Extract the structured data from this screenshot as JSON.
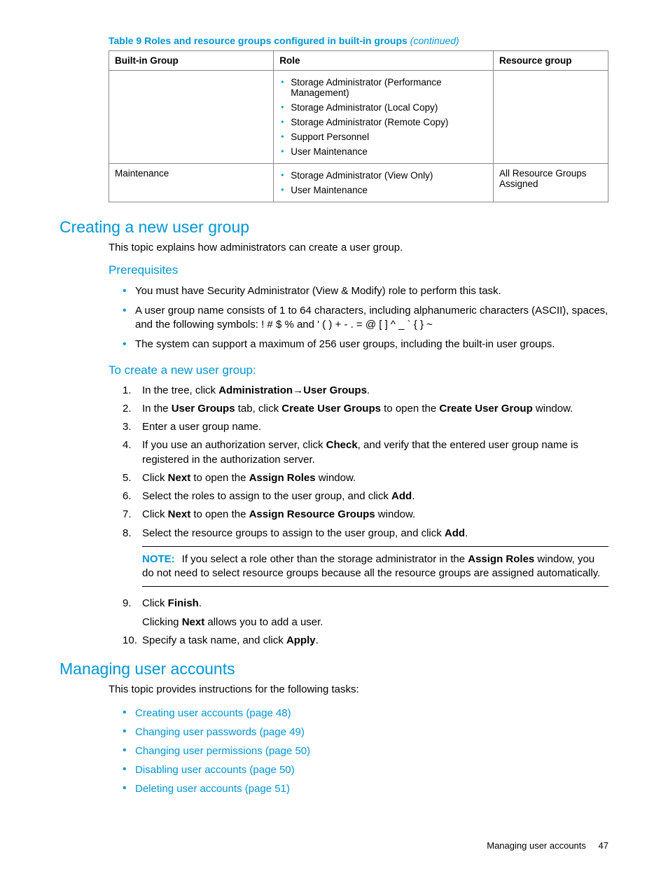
{
  "tableCaption": {
    "main": "Table 9 Roles and resource groups configured in built-in groups",
    "cont": "(continued)"
  },
  "table": {
    "headers": {
      "c1": "Built-in Group",
      "c2": "Role",
      "c3": "Resource group"
    },
    "row1": {
      "group": "",
      "roles": [
        "Storage Administrator (Performance Management)",
        "Storage Administrator (Local Copy)",
        "Storage Administrator (Remote Copy)",
        "Support Personnel",
        "User Maintenance"
      ],
      "rg": ""
    },
    "row2": {
      "group": "Maintenance",
      "roles": [
        "Storage Administrator (View Only)",
        "User Maintenance"
      ],
      "rg": "All Resource Groups Assigned"
    }
  },
  "s1": {
    "title": "Creating a new user group",
    "intro": "This topic explains how administrators can create a user group.",
    "prereqTitle": "Prerequisites",
    "prereqs": [
      "You must have Security Administrator (View & Modify) role to perform this task.",
      "A user group name consists of 1 to 64 characters, including alphanumeric characters (ASCII), spaces, and the following symbols: ! # $ % and ' ( ) + - . = @ [ ] ^ _ ` { } ~",
      "The system can support a maximum of 256 user groups, including the built-in user groups."
    ],
    "stepsTitle": "To create a new user group:",
    "steps": {
      "s1a": "In the tree, click ",
      "s1b": "Administration",
      "s1arrow": "→",
      "s1c": "User Groups",
      "s1d": ".",
      "s2a": "In the ",
      "s2b": "User Groups",
      "s2c": " tab, click ",
      "s2d": "Create User Groups",
      "s2e": " to open the ",
      "s2f": "Create User Group",
      "s2g": " window.",
      "s3": "Enter a user group name.",
      "s4a": "If you use an authorization server, click ",
      "s4b": "Check",
      "s4c": ", and verify that the entered user group name is registered in the authorization server.",
      "s5a": "Click ",
      "s5b": "Next",
      "s5c": " to open the ",
      "s5d": "Assign Roles",
      "s5e": " window.",
      "s6a": "Select the roles to assign to the user group, and click ",
      "s6b": "Add",
      "s6c": ".",
      "s7a": "Click ",
      "s7b": "Next",
      "s7c": " to open the ",
      "s7d": "Assign Resource Groups",
      "s7e": " window.",
      "s8a": "Select the resource groups to assign to the user group, and click ",
      "s8b": "Add",
      "s8c": ".",
      "note_label": "NOTE:",
      "note_a": "If you select a role other than the storage administrator in the ",
      "note_b": "Assign Roles",
      "note_c": " window, you do not need to select resource groups because all the resource groups are assigned automatically.",
      "s9a": "Click ",
      "s9b": "Finish",
      "s9c": ".",
      "s9sub_a": "Clicking ",
      "s9sub_b": "Next",
      "s9sub_c": " allows you to add a user.",
      "s10a": "Specify a task name, and click ",
      "s10b": "Apply",
      "s10c": "."
    }
  },
  "s2": {
    "title": "Managing user accounts",
    "intro": "This topic provides instructions for the following tasks:",
    "links": [
      "Creating user accounts (page 48)",
      "Changing user passwords (page 49)",
      "Changing user permissions (page 50)",
      "Disabling user accounts (page 50)",
      "Deleting user accounts (page 51)"
    ]
  },
  "footer": {
    "label": "Managing user accounts",
    "page": "47"
  }
}
